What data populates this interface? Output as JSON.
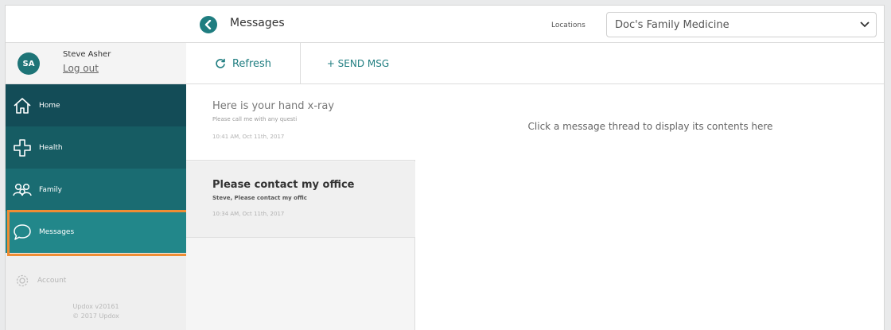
{
  "header": {
    "title": "Messages",
    "locations_label": "Locations",
    "location_value": "Doc's Family Medicine"
  },
  "user": {
    "initials": "SA",
    "name": "Steve Asher",
    "logout": "Log out"
  },
  "nav": {
    "home": "Home",
    "health": "Health",
    "family": "Family",
    "messages": "Messages",
    "account": "Account"
  },
  "footer": {
    "version": "Updox v20161",
    "copyright": "© 2017 Updox"
  },
  "toolbar": {
    "refresh": "Refresh",
    "send": "+ SEND MSG"
  },
  "threads": [
    {
      "subject": "Here is your hand x-ray",
      "preview": "Please call me with any questi",
      "time": "10:41 AM, Oct 11th, 2017"
    },
    {
      "subject": "Please contact my office",
      "preview": "Steve, Please contact my offic",
      "time": "10:34 AM, Oct 11th, 2017"
    }
  ],
  "content": {
    "placeholder": "Click a message thread to display its contents here"
  },
  "colors": {
    "accent": "#1f7d80",
    "highlight": "#ef8d33"
  }
}
